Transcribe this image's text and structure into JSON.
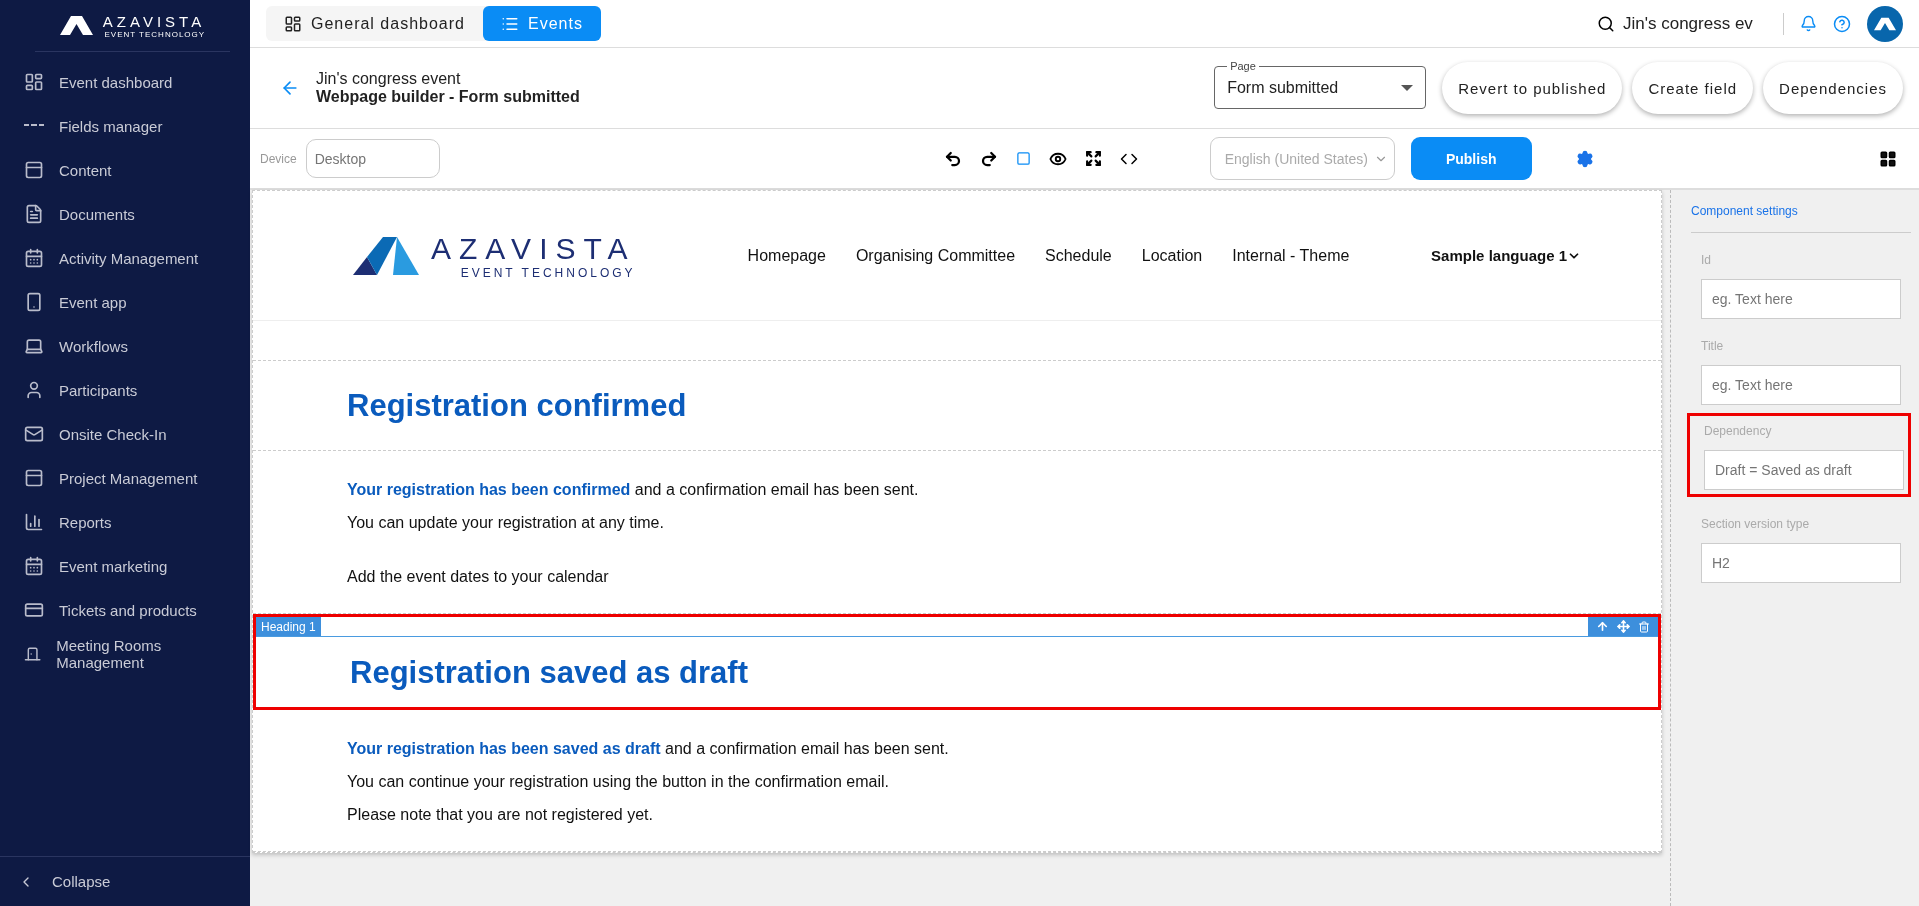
{
  "sidebar": {
    "logo": {
      "name": "AZAVISTA",
      "tagline": "EVENT TECHNOLOGY"
    },
    "items": [
      "Event dashboard",
      "Fields manager",
      "Content",
      "Documents",
      "Activity Management",
      "Event app",
      "Workflows",
      "Participants",
      "Onsite Check-In",
      "Project Management",
      "Reports",
      "Event marketing",
      "Tickets and products",
      "Meeting Rooms Management"
    ],
    "collapse": "Collapse"
  },
  "topbar": {
    "tabs": [
      {
        "label": "General dashboard",
        "selected": false
      },
      {
        "label": "Events",
        "selected": true
      }
    ],
    "search": {
      "value": "Jin's congress ev"
    }
  },
  "header": {
    "event_name": "Jin's congress event",
    "subtitle": "Webpage builder - Form submitted",
    "page_select": {
      "label": "Page",
      "value": "Form submitted"
    },
    "buttons": [
      "Revert to published",
      "Create field",
      "Dependencies"
    ]
  },
  "toolbar": {
    "device": {
      "label": "Device",
      "placeholder": "Desktop"
    },
    "language": "English (United States)",
    "publish": "Publish"
  },
  "canvas": {
    "site_header": {
      "logo": {
        "name": "AZAVISTA",
        "tagline": "EVENT TECHNOLOGY"
      },
      "nav": [
        "Homepage",
        "Organising Committee",
        "Schedule",
        "Location",
        "Internal - Theme"
      ],
      "language": "Sample language 1"
    },
    "sections": [
      {
        "kind": "heading",
        "text": "Registration confirmed",
        "selected": false
      },
      {
        "kind": "paragraphs",
        "lines": [
          "**Your registration has been confirmed** and a confirmation email has been sent.",
          "You can update your registration at any time."
        ],
        "note": "Add the event dates to your calendar"
      },
      {
        "kind": "heading",
        "text": "Registration saved as draft",
        "selected": true,
        "tag": "Heading 1"
      },
      {
        "kind": "paragraphs",
        "lines": [
          "**Your registration has been saved as draft** and a confirmation email has been sent.",
          "You can continue your registration using the button in the confirmation email.",
          "Please note that you are not registered yet."
        ]
      }
    ]
  },
  "panel": {
    "title": "Component settings",
    "fields": [
      {
        "label": "Id",
        "placeholder": "eg. Text here",
        "highlighted": false
      },
      {
        "label": "Title",
        "placeholder": "eg. Text here",
        "highlighted": false
      },
      {
        "label": "Dependency",
        "placeholder": "Draft = Saved as draft",
        "highlighted": true
      },
      {
        "label": "Section version type",
        "placeholder": "H2",
        "highlighted": false
      }
    ]
  }
}
